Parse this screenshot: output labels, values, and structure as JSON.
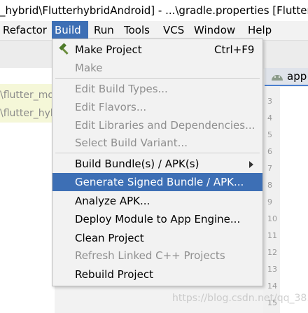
{
  "window": {
    "title": "_hybrid\\FlutterhybridAndroid] - ...\\gradle.properties [Flutterh"
  },
  "menubar": {
    "items": [
      {
        "label": "Refactor"
      },
      {
        "label": "Build"
      },
      {
        "label": "Run"
      },
      {
        "label": "Tools"
      },
      {
        "label": "VCS"
      },
      {
        "label": "Window"
      },
      {
        "label": "Help"
      }
    ]
  },
  "editor": {
    "tab_label": "app",
    "path_lines": [
      "\\flutter_mo",
      "\\flutter_hyb"
    ],
    "line_numbers": [
      "3",
      "4",
      "5",
      "6",
      "7",
      "8",
      "9",
      "10",
      "11",
      "12",
      "13",
      "14",
      "15"
    ]
  },
  "build_menu": {
    "items": [
      {
        "label": "Make Project",
        "shortcut": "Ctrl+F9",
        "icon": "hammer-icon"
      },
      {
        "label": "Make"
      },
      {
        "label": "Edit Build Types..."
      },
      {
        "label": "Edit Flavors..."
      },
      {
        "label": "Edit Libraries and Dependencies..."
      },
      {
        "label": "Select Build Variant..."
      },
      {
        "label": "Build Bundle(s) / APK(s)"
      },
      {
        "label": "Generate Signed Bundle / APK..."
      },
      {
        "label": "Analyze APK..."
      },
      {
        "label": "Deploy Module to App Engine..."
      },
      {
        "label": "Clean Project"
      },
      {
        "label": "Refresh Linked C++ Projects"
      },
      {
        "label": "Rebuild Project"
      }
    ]
  },
  "watermark": "https://blog.csdn.net/qq_38..."
}
